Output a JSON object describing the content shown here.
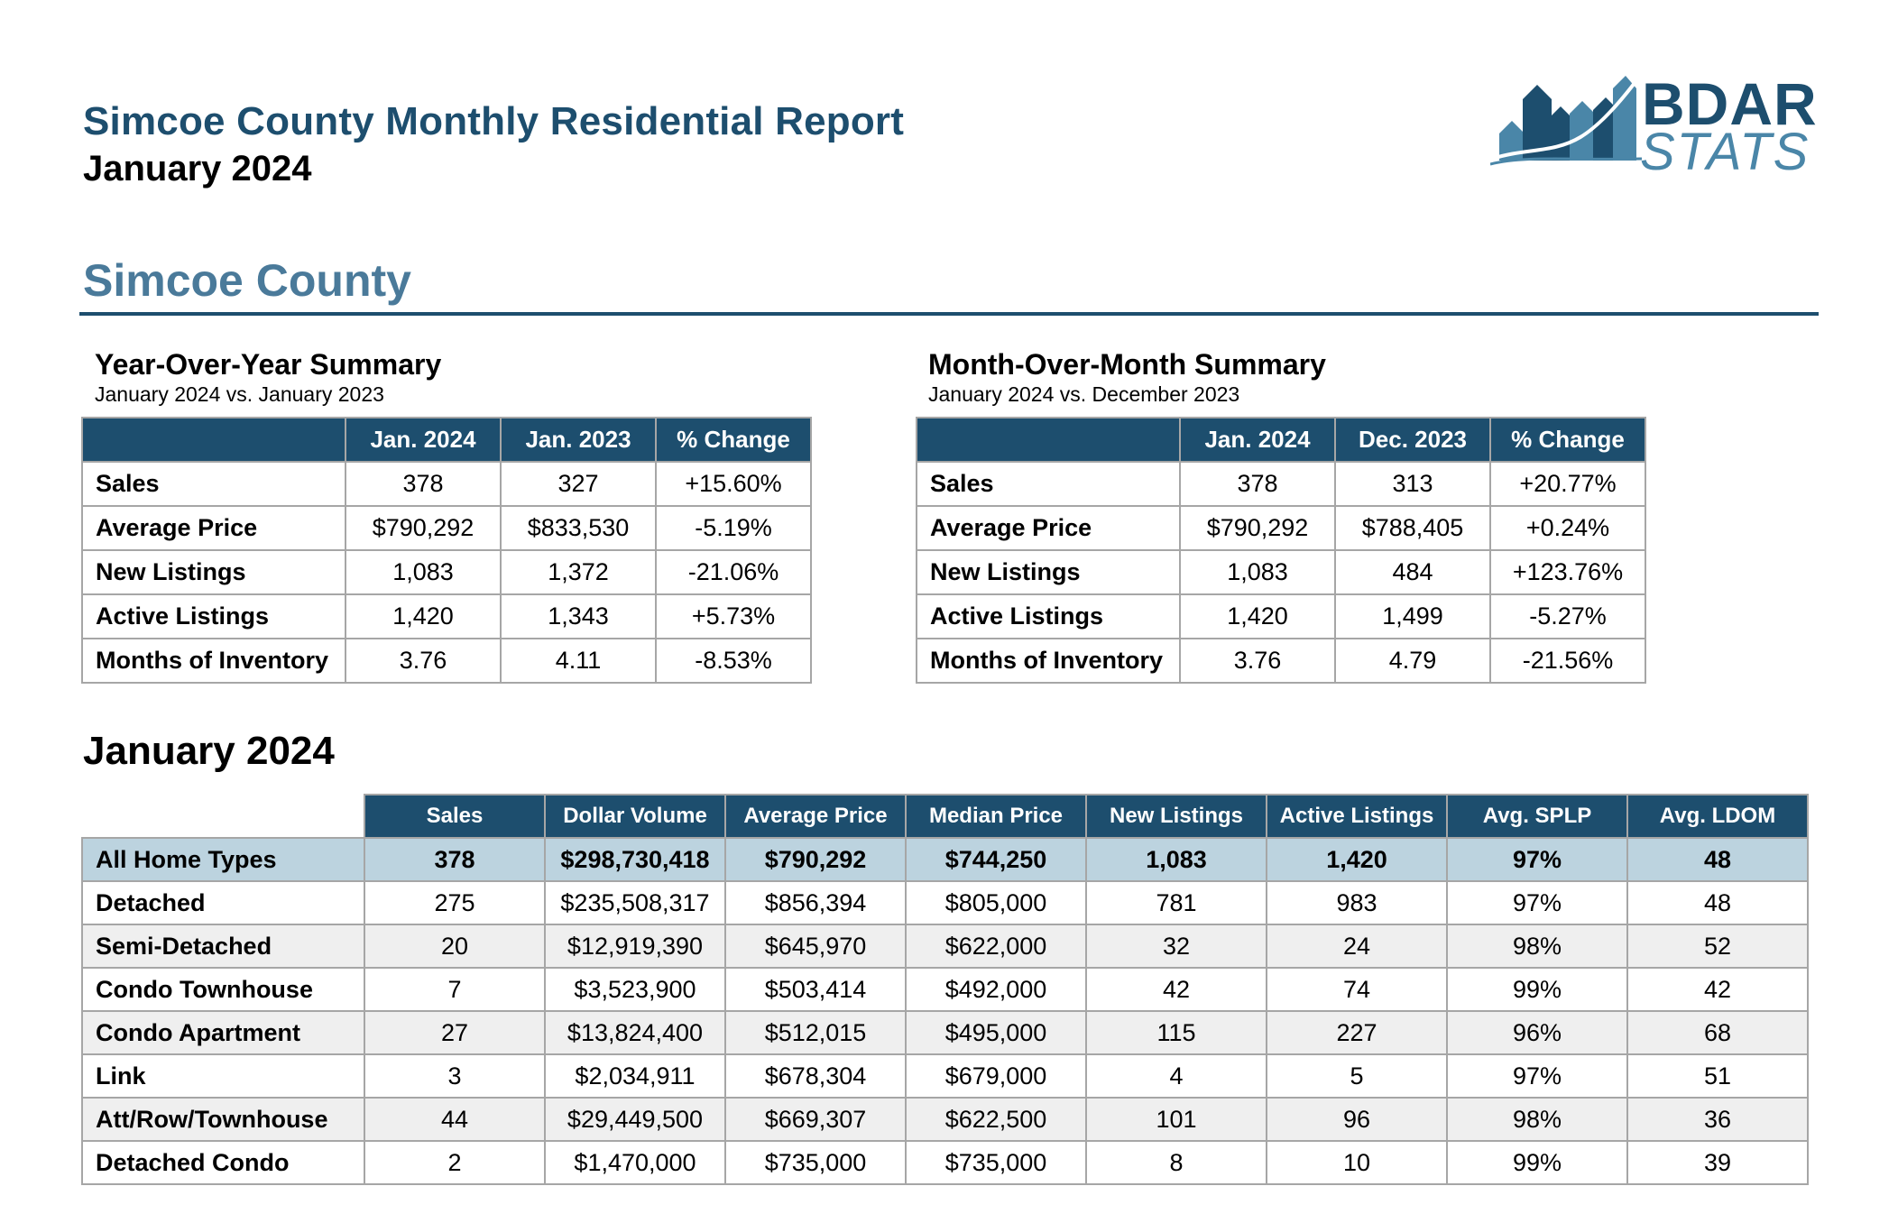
{
  "header": {
    "title": "Simcoe County Monthly Residential Report",
    "subtitle": "January 2024"
  },
  "logo": {
    "line1": "BDAR",
    "line2": "STATS",
    "icon": "house-chart-logo-icon",
    "colors": {
      "dark": "#1d4e6e",
      "light": "#4a86a8"
    }
  },
  "section": {
    "title": "Simcoe County"
  },
  "yoy": {
    "title": "Year-Over-Year Summary",
    "subtitle": "January 2024 vs. January 2023",
    "columns": [
      "Jan. 2024",
      "Jan. 2023",
      "% Change"
    ],
    "rows": [
      {
        "label": "Sales",
        "values": [
          "378",
          "327",
          "+15.60%"
        ]
      },
      {
        "label": "Average Price",
        "values": [
          "$790,292",
          "$833,530",
          "-5.19%"
        ]
      },
      {
        "label": "New Listings",
        "values": [
          "1,083",
          "1,372",
          "-21.06%"
        ]
      },
      {
        "label": "Active Listings",
        "values": [
          "1,420",
          "1,343",
          "+5.73%"
        ]
      },
      {
        "label": "Months of Inventory",
        "values": [
          "3.76",
          "4.11",
          "-8.53%"
        ]
      }
    ]
  },
  "mom": {
    "title": "Month-Over-Month Summary",
    "subtitle": "January 2024 vs. December 2023",
    "columns": [
      "Jan. 2024",
      "Dec. 2023",
      "% Change"
    ],
    "rows": [
      {
        "label": "Sales",
        "values": [
          "378",
          "313",
          "+20.77%"
        ]
      },
      {
        "label": "Average Price",
        "values": [
          "$790,292",
          "$788,405",
          "+0.24%"
        ]
      },
      {
        "label": "New Listings",
        "values": [
          "1,083",
          "484",
          "+123.76%"
        ]
      },
      {
        "label": "Active Listings",
        "values": [
          "1,420",
          "1,499",
          "-5.27%"
        ]
      },
      {
        "label": "Months of Inventory",
        "values": [
          "3.76",
          "4.79",
          "-21.56%"
        ]
      }
    ]
  },
  "monthly": {
    "title": "January 2024",
    "columns": [
      "Sales",
      "Dollar Volume",
      "Average Price",
      "Median Price",
      "New Listings",
      "Active Listings",
      "Avg. SPLP",
      "Avg. LDOM"
    ],
    "rows": [
      {
        "label": "All Home Types",
        "values": [
          "378",
          "$298,730,418",
          "$790,292",
          "$744,250",
          "1,083",
          "1,420",
          "97%",
          "48"
        ]
      },
      {
        "label": "Detached",
        "values": [
          "275",
          "$235,508,317",
          "$856,394",
          "$805,000",
          "781",
          "983",
          "97%",
          "48"
        ]
      },
      {
        "label": "Semi-Detached",
        "values": [
          "20",
          "$12,919,390",
          "$645,970",
          "$622,000",
          "32",
          "24",
          "98%",
          "52"
        ]
      },
      {
        "label": "Condo Townhouse",
        "values": [
          "7",
          "$3,523,900",
          "$503,414",
          "$492,000",
          "42",
          "74",
          "99%",
          "42"
        ]
      },
      {
        "label": "Condo Apartment",
        "values": [
          "27",
          "$13,824,400",
          "$512,015",
          "$495,000",
          "115",
          "227",
          "96%",
          "68"
        ]
      },
      {
        "label": "Link",
        "values": [
          "3",
          "$2,034,911",
          "$678,304",
          "$679,000",
          "4",
          "5",
          "97%",
          "51"
        ]
      },
      {
        "label": "Att/Row/Townhouse",
        "values": [
          "44",
          "$29,449,500",
          "$669,307",
          "$622,500",
          "101",
          "96",
          "98%",
          "36"
        ]
      },
      {
        "label": "Detached Condo",
        "values": [
          "2",
          "$1,470,000",
          "$735,000",
          "$735,000",
          "8",
          "10",
          "99%",
          "39"
        ]
      }
    ]
  },
  "colors": {
    "header_fill": "#1d4e6e",
    "section_heading": "#4a7a9a",
    "total_row_fill": "#bcd3df",
    "alt_row_fill": "#efefef",
    "border": "#a6a6a6"
  }
}
